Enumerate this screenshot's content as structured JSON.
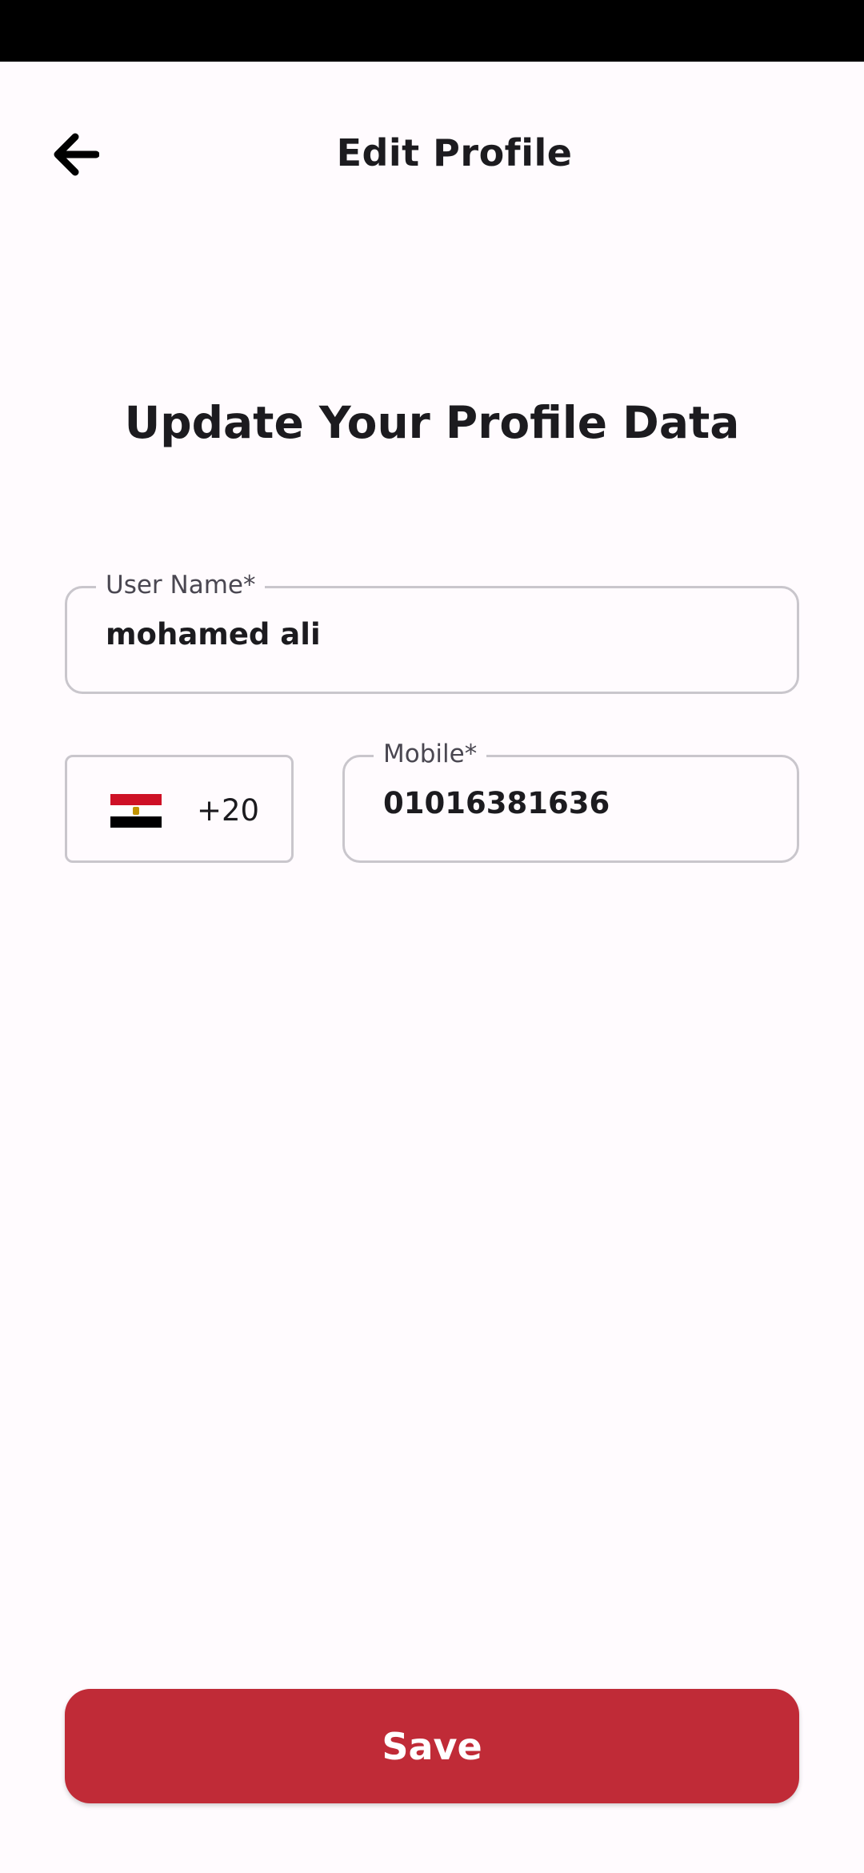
{
  "app_bar": {
    "title": "Edit Profile",
    "back_icon": "arrow-back-icon"
  },
  "form": {
    "heading": "Update Your Profile Data",
    "username": {
      "label": "User Name*",
      "value": "mohamed ali"
    },
    "country": {
      "flag_icon": "egypt-flag-icon",
      "dial_code": "+20"
    },
    "mobile": {
      "label": "Mobile*",
      "value": "01016381636"
    }
  },
  "actions": {
    "save_label": "Save"
  },
  "colors": {
    "background": "#FFFBFE",
    "primary": "#C02B37",
    "field_border": "#C9C6CC",
    "text": "#1C1B1F"
  }
}
